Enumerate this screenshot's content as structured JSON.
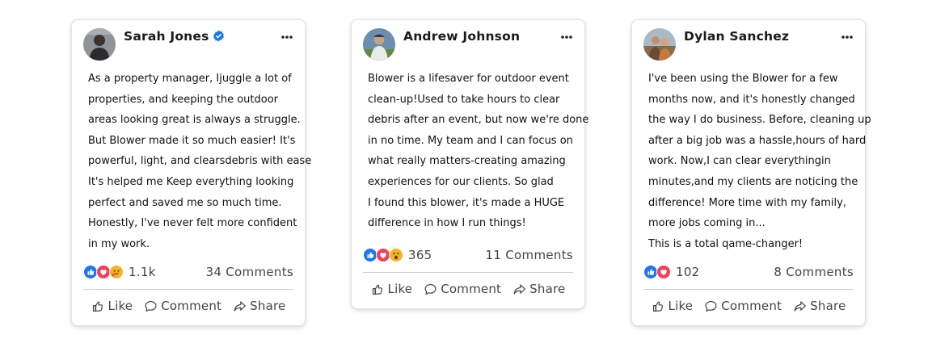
{
  "colors": {
    "like_blue": "#1877f2",
    "love_red": "#f33e58",
    "haha_yellow": "#f7b125",
    "text": "#111111",
    "meta": "#444444"
  },
  "actions": {
    "like": "Like",
    "comment": "Comment",
    "share": "Share"
  },
  "posts": [
    {
      "name": "Sarah Jones",
      "verified": true,
      "avatar_icon": "person-avatar",
      "lines": [
        "As a property manager, Ijuggle a lot of",
        "properties, and keeping the outdoor",
        "areas looking great is always a struggle.",
        "But Blower made it so much easier! It's",
        "powerful, light, and clearsdebris with ease",
        "It's helped me Keep everything looking",
        "perfect and saved me so much time.",
        "Honestly, I've never felt more confident",
        "in my work."
      ],
      "reactions": [
        "like",
        "love",
        "care"
      ],
      "reaction_count": "1.1k",
      "comments": "34 Comments"
    },
    {
      "name": "Andrew Johnson",
      "verified": false,
      "avatar_icon": "person-avatar",
      "lines": [
        "Blower is a lifesaver for outdoor event",
        "clean-up!Used to take hours to clear",
        "debris after an event, but now we're done",
        "in no time. My team and I can focus on",
        "what really matters-creating amazing",
        "experiences for our clients. So glad",
        "I found this blower, it's made a HUGE",
        "difference in how I run things!"
      ],
      "reactions": [
        "like",
        "love",
        "wow"
      ],
      "reaction_count": "365",
      "comments": "11 Comments"
    },
    {
      "name": "Dylan Sanchez",
      "verified": false,
      "avatar_icon": "person-avatar",
      "lines": [
        "I've been using the Blower for a few",
        "months now, and it's honestly changed",
        "the way I do business. Before, cleaning up",
        "after a big job was a hassle,hours of hard",
        "work. Now,I can clear everythingin",
        "minutes,and my clients are noticing the",
        "difference! More time with my family,",
        "more jobs coming in...",
        "This is a total qame-changer!"
      ],
      "reactions": [
        "like",
        "love"
      ],
      "reaction_count": "102",
      "comments": "8 Comments"
    }
  ]
}
